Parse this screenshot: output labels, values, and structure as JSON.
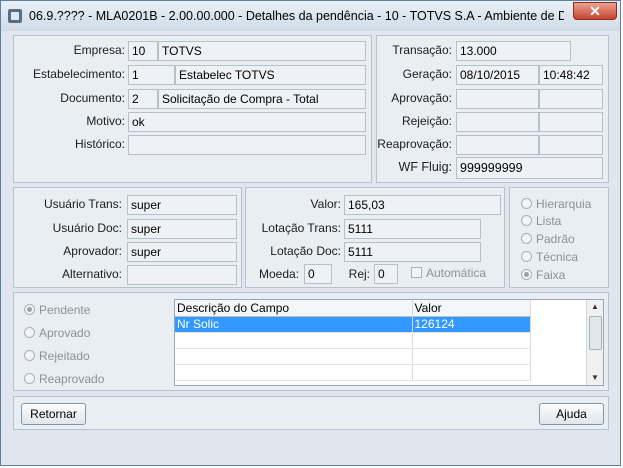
{
  "window": {
    "title": "06.9.???? - MLA0201B - 2.00.00.000 - Detalhes da pendência - 10 - TOTVS S.A - Ambiente de Desenvolv...",
    "close_symbol": "✕"
  },
  "document": {
    "empresa_label": "Empresa:",
    "empresa_code": "10",
    "empresa_name": "TOTVS",
    "estab_label": "Estabelecimento:",
    "estab_code": "1",
    "estab_name": "Estabelec TOTVS",
    "documento_label": "Documento:",
    "documento_code": "2",
    "documento_name": "Solicitação de Compra - Total",
    "motivo_label": "Motivo:",
    "motivo_value": "ok",
    "historico_label": "Histórico:",
    "historico_value": ""
  },
  "transaction": {
    "transacao_label": "Transação:",
    "transacao_value": "13.000",
    "geracao_label": "Geração:",
    "geracao_date": "08/10/2015",
    "geracao_time": "10:48:42",
    "aprovacao_label": "Aprovação:",
    "rejeicao_label": "Rejeição:",
    "reaprovacao_label": "Reaprovação:",
    "wf_label": "WF Fluig:",
    "wf_value": "999999999"
  },
  "users": {
    "usuario_trans_label": "Usuário Trans:",
    "usuario_trans": "super",
    "usuario_doc_label": "Usuário Doc:",
    "usuario_doc": "super",
    "aprovador_label": "Aprovador:",
    "aprovador": "super",
    "alternativo_label": "Alternativo:",
    "alternativo": ""
  },
  "values": {
    "valor_label": "Valor:",
    "valor": "165,03",
    "lotacao_trans_label": "Lotação Trans:",
    "lotacao_trans": "5111",
    "lotacao_doc_label": "Lotação Doc:",
    "lotacao_doc": "5111",
    "moeda_label": "Moeda:",
    "moeda": "0",
    "rej_label": "Rej:",
    "rej": "0",
    "automatica_label": "Automática"
  },
  "type_options": {
    "items": [
      "Hierarquia",
      "Lista",
      "Padrão",
      "Técnica",
      "Faixa"
    ],
    "selected": "Faixa"
  },
  "status_options": {
    "items": [
      "Pendente",
      "Aprovado",
      "Rejeitado",
      "Reaprovado"
    ],
    "selected": "Pendente"
  },
  "grid": {
    "columns": [
      "Descrição do Campo",
      "Valor"
    ],
    "rows": [
      [
        "Nr Solic",
        "126124"
      ]
    ]
  },
  "buttons": {
    "retornar": "Retornar",
    "ajuda": "Ajuda"
  }
}
